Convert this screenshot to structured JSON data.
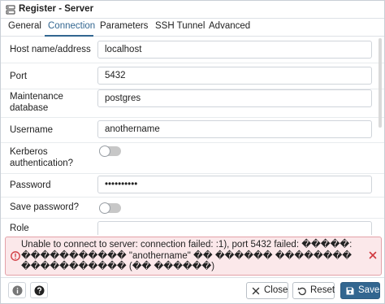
{
  "window": {
    "title": "Register - Server"
  },
  "tabs": [
    {
      "label": "General"
    },
    {
      "label": "Connection"
    },
    {
      "label": "Parameters"
    },
    {
      "label": "SSH Tunnel"
    },
    {
      "label": "Advanced"
    }
  ],
  "active_tab": "Connection",
  "form": {
    "host": {
      "label": "Host name/address",
      "value": "localhost"
    },
    "port": {
      "label": "Port",
      "value": "5432"
    },
    "maintenance_db": {
      "label_line1": "Maintenance",
      "label_line2": "database",
      "value": "postgres"
    },
    "username": {
      "label": "Username",
      "value": "anothername"
    },
    "kerberos": {
      "label_line1": "Kerberos",
      "label_line2": "authentication?",
      "enabled": false
    },
    "password": {
      "label": "Password",
      "value": "••••••••••"
    },
    "save_password": {
      "label": "Save password?",
      "enabled": false
    },
    "role": {
      "label": "Role",
      "value": ""
    }
  },
  "error": {
    "line1": "Unable to connect to server: connection failed: :1), port 5432 failed: �����:",
    "line2": "����������� \"anothername\" �� ������ ��������",
    "line3": "����������� (�� ������)"
  },
  "footer": {
    "info_icon": "info-icon",
    "help_icon": "help-icon",
    "close_label": "Close",
    "reset_label": "Reset",
    "save_label": "Save"
  },
  "colors": {
    "accent": "#326690",
    "error_bg": "#fbe8ea",
    "error_border": "#e3a1a8",
    "error_icon": "#d0393f"
  }
}
